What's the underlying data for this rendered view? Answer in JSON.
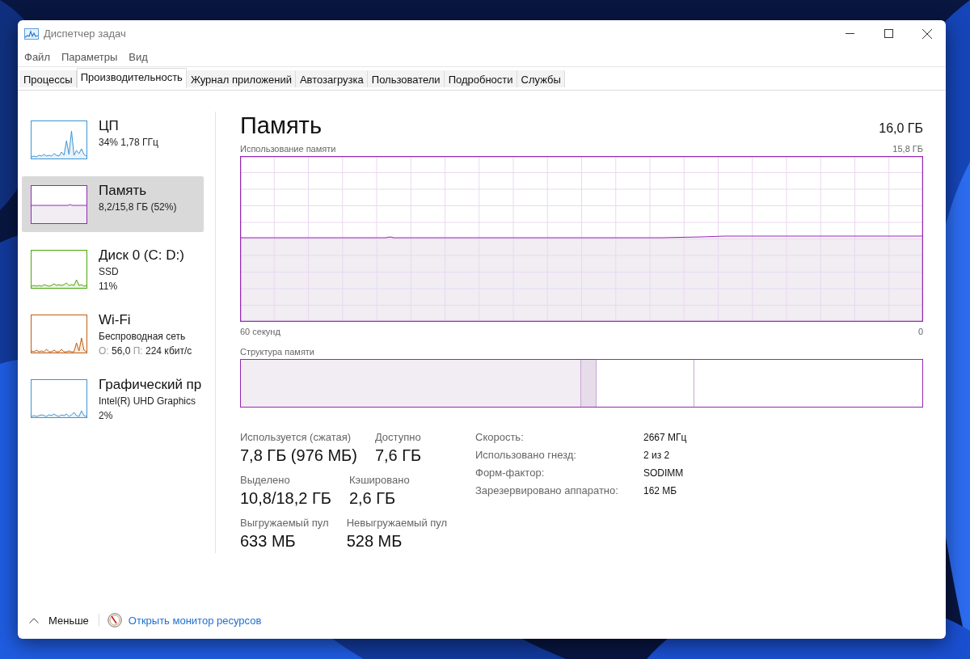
{
  "window": {
    "title": "Диспетчер задач"
  },
  "menu": [
    "Файл",
    "Параметры",
    "Вид"
  ],
  "tabs": [
    {
      "label": "Процессы",
      "selected": false
    },
    {
      "label": "Производительность",
      "selected": true
    },
    {
      "label": "Журнал приложений",
      "selected": false
    },
    {
      "label": "Автозагрузка",
      "selected": false
    },
    {
      "label": "Пользователи",
      "selected": false
    },
    {
      "label": "Подробности",
      "selected": false
    },
    {
      "label": "Службы",
      "selected": false
    }
  ],
  "sidebar": {
    "items": [
      {
        "kind": "spiky",
        "title": "ЦП",
        "lines": [
          [
            {
              "text": "34%  1,78 ГГц",
              "muted": false
            }
          ]
        ],
        "color": "#3f94d2",
        "selected": false
      },
      {
        "kind": "flat",
        "title": "Память",
        "lines": [
          [
            {
              "text": "8,2/15,8 ГБ (52%)",
              "muted": false
            }
          ]
        ],
        "color": "#9528b4",
        "selected": true
      },
      {
        "kind": "spiky",
        "title": "Диск 0 (C: D:)",
        "lines": [
          [
            {
              "text": "SSD",
              "muted": false
            }
          ],
          [
            {
              "text": "11%",
              "muted": false
            }
          ]
        ],
        "color": "#4da60c",
        "selected": false
      },
      {
        "kind": "spiky",
        "title": "Wi-Fi",
        "lines": [
          [
            {
              "text": "Беспроводная сеть",
              "muted": false
            }
          ],
          [
            {
              "text": "О:",
              "muted": true
            },
            {
              "text": " 56,0 ",
              "muted": false
            },
            {
              "text": "П:",
              "muted": true
            },
            {
              "text": " 224 кбит/с",
              "muted": false
            }
          ]
        ],
        "color": "#c15d0f",
        "selected": false
      },
      {
        "kind": "spiky",
        "title": "Графический пр",
        "lines": [
          [
            {
              "text": "Intel(R) UHD Graphics",
              "muted": false
            }
          ],
          [
            {
              "text": "2%",
              "muted": false
            }
          ]
        ],
        "color": "#3f94d2",
        "selected": false
      }
    ]
  },
  "detail": {
    "title": "Память",
    "total": "16,0 ГБ",
    "usage_chart": {
      "caption": "Использование памяти",
      "max": "15,8 ГБ",
      "x_start": "60 секунд",
      "x_end": "0"
    },
    "composition": {
      "caption": "Структура памяти"
    },
    "stats": [
      [
        {
          "label": "Используется (сжатая)",
          "value": "7,8 ГБ (976 МБ)"
        },
        {
          "label": "Доступно",
          "value": "7,6 ГБ"
        }
      ],
      [
        {
          "label": "Выделено",
          "value": "10,8/18,2 ГБ"
        },
        {
          "label": "Кэшировано",
          "value": "2,6 ГБ"
        }
      ],
      [
        {
          "label": "Выгружаемый пул",
          "value": "633 МБ"
        },
        {
          "label": "Невыгружаемый пул",
          "value": "528 МБ"
        }
      ]
    ],
    "specs": [
      {
        "label": "Скорость:",
        "value": "2667 МГц"
      },
      {
        "label": "Использовано гнезд:",
        "value": "2 из 2"
      },
      {
        "label": "Форм-фактор:",
        "value": "SODIMM"
      },
      {
        "label": "Зарезервировано аппаратно:",
        "value": "162 МБ"
      }
    ]
  },
  "footer": {
    "less": "Меньше",
    "link": "Открыть монитор ресурсов"
  }
}
